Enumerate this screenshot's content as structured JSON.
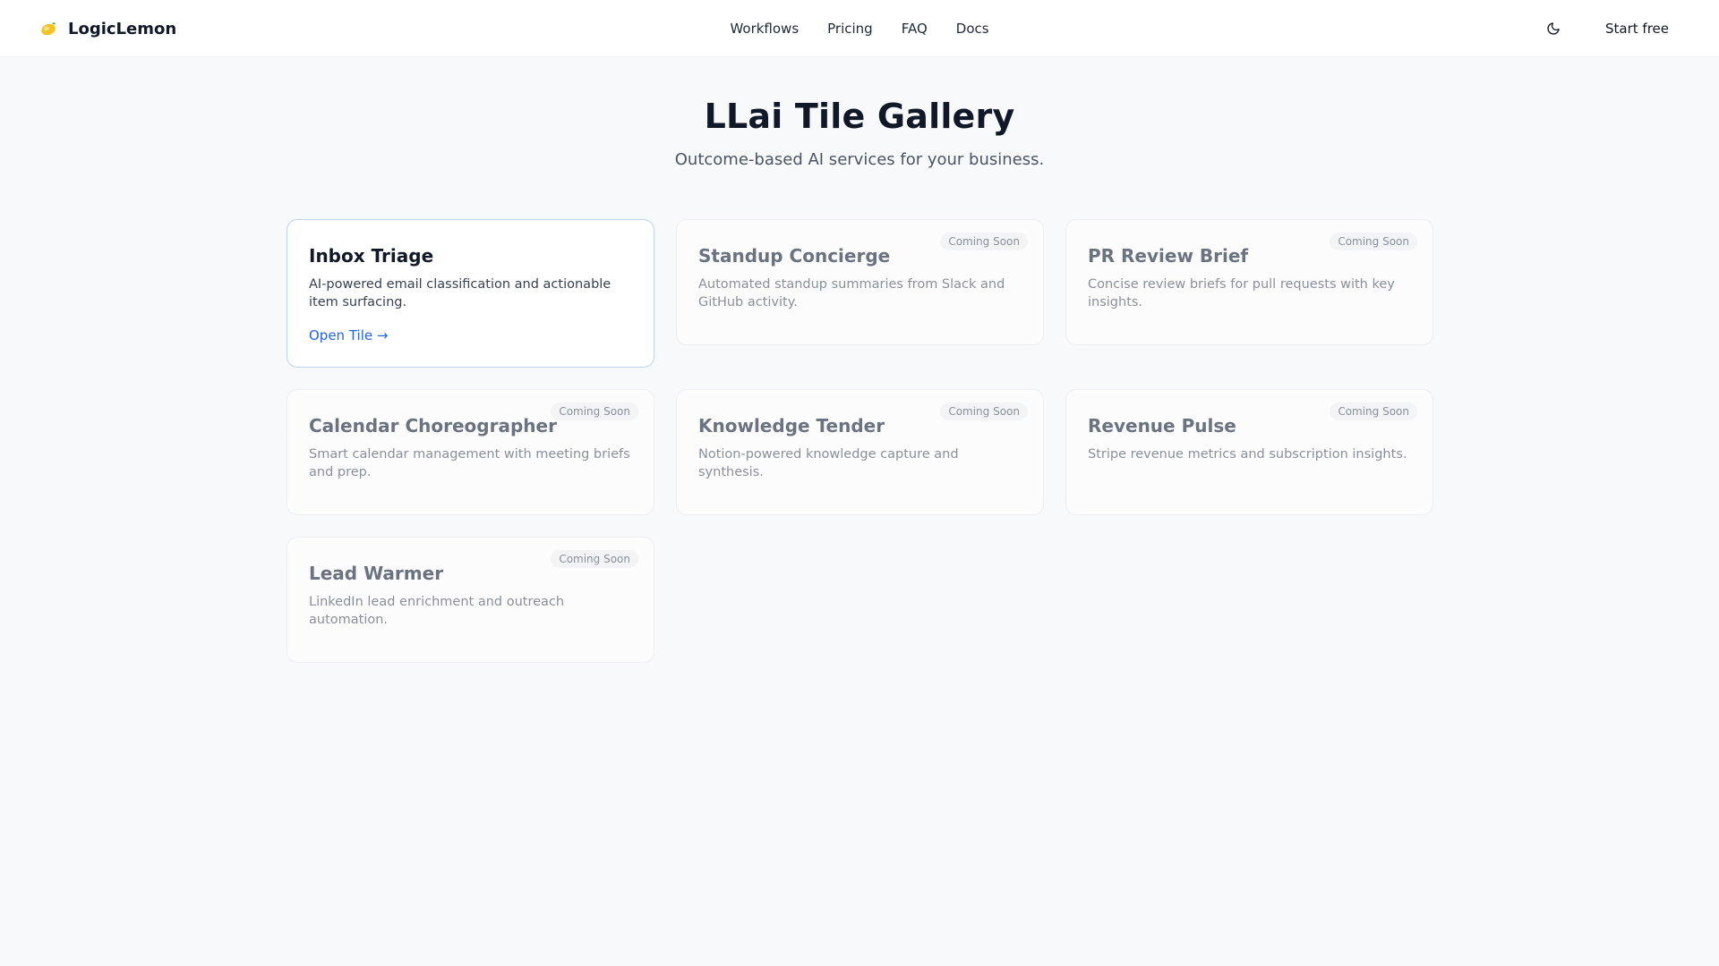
{
  "header": {
    "brand": "LogicLemon",
    "brand_icon": "lemon-icon",
    "nav": [
      "Workflows",
      "Pricing",
      "FAQ",
      "Docs"
    ],
    "theme_icon": "moon-icon",
    "start_free": "Start free"
  },
  "hero": {
    "title": "LLai Tile Gallery",
    "subtitle": "Outcome-based AI services for your business."
  },
  "tiles": [
    {
      "title": "Inbox Triage",
      "description": "AI-powered email classification and actionable item surfacing.",
      "link": "Open Tile →",
      "status": "active"
    },
    {
      "title": "Standup Concierge",
      "description": "Automated standup summaries from Slack and GitHub activity.",
      "badge": "Coming Soon",
      "status": "soon"
    },
    {
      "title": "PR Review Brief",
      "description": "Concise review briefs for pull requests with key insights.",
      "badge": "Coming Soon",
      "status": "soon"
    },
    {
      "title": "Calendar Choreographer",
      "description": "Smart calendar management with meeting briefs and prep.",
      "badge": "Coming Soon",
      "status": "soon"
    },
    {
      "title": "Knowledge Tender",
      "description": "Notion-powered knowledge capture and synthesis.",
      "badge": "Coming Soon",
      "status": "soon"
    },
    {
      "title": "Revenue Pulse",
      "description": "Stripe revenue metrics and subscription insights.",
      "badge": "Coming Soon",
      "status": "soon"
    },
    {
      "title": "Lead Warmer",
      "description": "LinkedIn lead enrichment and outreach automation.",
      "badge": "Coming Soon",
      "status": "soon"
    }
  ],
  "colors": {
    "accent": "#2563eb",
    "active_border": "#bfd4f2",
    "background": "#f8f9fb"
  }
}
